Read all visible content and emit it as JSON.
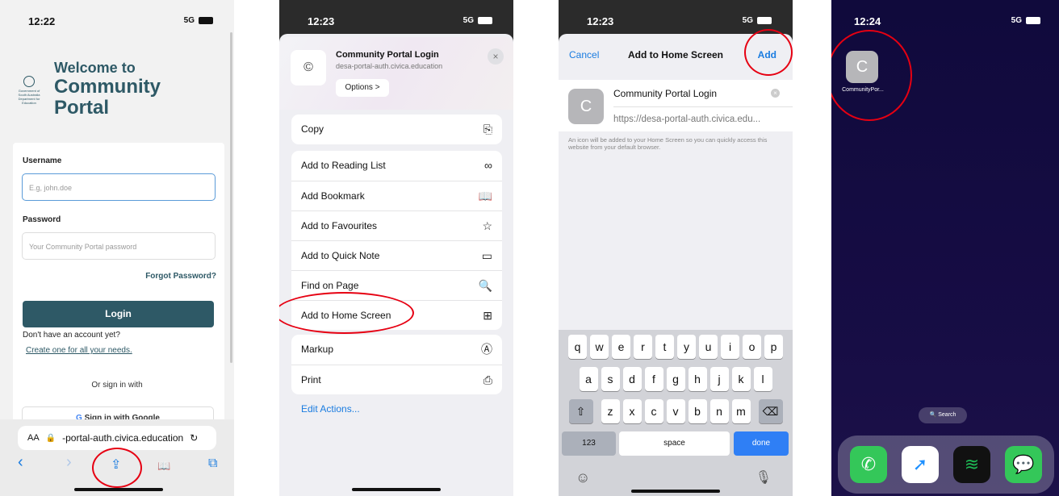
{
  "colors": {
    "annotation": "#e60012",
    "portal_teal": "#2e5966",
    "ios_blue": "#1a7ce0"
  },
  "phone1": {
    "time": "12:22",
    "network": "5G",
    "crest_text": "Government of South Australia Department for Education",
    "welcome_line1": "Welcome to",
    "welcome_line2": "Community",
    "welcome_line3": "Portal",
    "username_label": "Username",
    "username_placeholder": "E.g, john.doe",
    "password_label": "Password",
    "password_placeholder": "Your Community Portal password",
    "forgot": "Forgot Password?",
    "login": "Login",
    "no_account": "Don't have an account yet?",
    "create": "Create one for all your needs.",
    "or_sign": "Or sign in with",
    "google_g": "G",
    "google": "Sign in with Google",
    "aa": "AA",
    "url": "-portal-auth.civica.education",
    "reload": "↻",
    "toolbar": {
      "back": "‹",
      "forward": "›",
      "share": "⇪",
      "bookmarks": "📖",
      "tabs": "⧉"
    }
  },
  "phone2": {
    "time": "12:23",
    "network": "5G",
    "title": "Community Portal Login",
    "subtitle": "desa-portal-auth.civica.education",
    "options": "Options >",
    "close": "×",
    "site_icon": "©",
    "group1": [
      {
        "label": "Copy",
        "icon": "⎘"
      }
    ],
    "group2": [
      {
        "label": "Add to Reading List",
        "icon": "∞"
      },
      {
        "label": "Add Bookmark",
        "icon": "📖"
      },
      {
        "label": "Add to Favourites",
        "icon": "☆"
      },
      {
        "label": "Add to Quick Note",
        "icon": "▭"
      },
      {
        "label": "Find on Page",
        "icon": "🔍"
      },
      {
        "label": "Add to Home Screen",
        "icon": "⊞"
      }
    ],
    "group3": [
      {
        "label": "Markup",
        "icon": "Ⓐ"
      },
      {
        "label": "Print",
        "icon": "⎙"
      }
    ],
    "edit_actions": "Edit Actions..."
  },
  "phone3": {
    "time": "12:23",
    "network": "5G",
    "cancel": "Cancel",
    "title": "Add to Home Screen",
    "add": "Add",
    "icon_letter": "C",
    "app_name": "Community Portal Login",
    "app_url": "https://desa-portal-auth.civica.edu...",
    "clear": "×",
    "note": "An icon will be added to your Home Screen so you can quickly access this website from your default browser.",
    "keys_row1": [
      "q",
      "w",
      "e",
      "r",
      "t",
      "y",
      "u",
      "i",
      "o",
      "p"
    ],
    "keys_row2": [
      "a",
      "s",
      "d",
      "f",
      "g",
      "h",
      "j",
      "k",
      "l"
    ],
    "keys_row3": [
      "z",
      "x",
      "c",
      "v",
      "b",
      "n",
      "m"
    ],
    "shift": "⇧",
    "delete": "⌫",
    "k123": "123",
    "space": "space",
    "done": "done",
    "emoji": "☺",
    "mic": "🎙"
  },
  "phone4": {
    "time": "12:24",
    "network": "5G",
    "icon_letter": "C",
    "icon_label": "CommunityPor...",
    "search": "🔍 Search",
    "dock_icons": [
      {
        "name": "phone",
        "glyph": "✆",
        "color": "#34c759"
      },
      {
        "name": "safari",
        "glyph": "➚",
        "color": "#1e90ff"
      },
      {
        "name": "spotify",
        "glyph": "≋",
        "color": "#1db954"
      },
      {
        "name": "messages",
        "glyph": "💬",
        "color": "#34c759"
      }
    ]
  }
}
